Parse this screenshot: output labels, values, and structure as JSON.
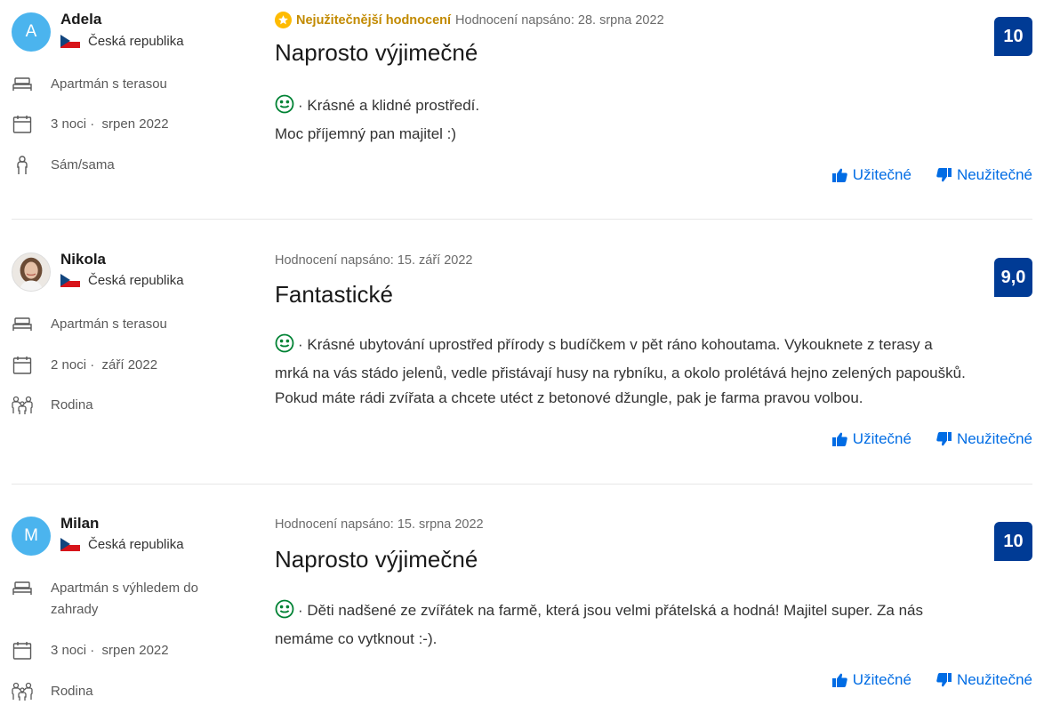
{
  "reviews": [
    {
      "reviewer": {
        "initial": "A",
        "name": "Adela",
        "country": "Česká republika",
        "avatar": "initial"
      },
      "room": "Apartmán s terasou",
      "stay_nights": "3 noci ·",
      "stay_month": "srpen 2022",
      "traveler": "Sám/sama",
      "traveler_icon": "person-icon",
      "most_helpful_label": "Nejužitečnější hodnocení",
      "posted": "Hodnocení napsáno: 28. srpna 2022",
      "title": "Naprosto výjimečné",
      "text_lines": [
        "· Krásné a klidné prostředí.",
        "Moc příjemný pan majitel :)"
      ],
      "score": "10",
      "helpful": "Užitečné",
      "not_helpful": "Neužitečné"
    },
    {
      "reviewer": {
        "initial": "",
        "name": "Nikola",
        "country": "Česká republika",
        "avatar": "photo"
      },
      "room": "Apartmán s terasou",
      "stay_nights": "2 noci ·",
      "stay_month": "září 2022",
      "traveler": "Rodina",
      "traveler_icon": "family-icon",
      "posted": "Hodnocení napsáno: 15. září 2022",
      "title": "Fantastické",
      "text_lines": [
        "· Krásné ubytování uprostřed přírody s budíčkem v pět ráno kohoutama. Vykouknete z terasy a",
        "mrká na vás stádo jelenů, vedle přistávají husy na rybníku, a okolo prolétává hejno zelených papoušků.",
        "Pokud máte rádi zvířata a chcete utéct z betonové džungle, pak je farma pravou volbou."
      ],
      "score": "9,0",
      "helpful": "Užitečné",
      "not_helpful": "Neužitečné"
    },
    {
      "reviewer": {
        "initial": "M",
        "name": "Milan",
        "country": "Česká republika",
        "avatar": "initial"
      },
      "room_lines": [
        "Apartmán s výhledem do",
        "zahrady"
      ],
      "stay_nights": "3 noci ·",
      "stay_month": "srpen 2022",
      "traveler": "Rodina",
      "traveler_icon": "family-icon",
      "posted": "Hodnocení napsáno: 15. srpna 2022",
      "title": "Naprosto výjimečné",
      "text_lines": [
        "· Děti nadšené ze zvířátek na farmě, která jsou velmi přátelská a hodná! Majitel super. Za nás",
        "nemáme co vytknout :-)."
      ],
      "score": "10",
      "helpful": "Užitečné",
      "not_helpful": "Neužitečné"
    }
  ],
  "colors": {
    "score_bg": "#003b95",
    "link": "#006ce4",
    "avatar_bg": "#4bb4ee",
    "helpful_badge": "#febb02",
    "smile": "#008234"
  }
}
